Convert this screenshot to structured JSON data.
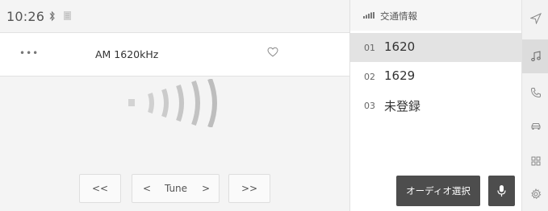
{
  "status_bar": {
    "time": "10:26",
    "icons": [
      "bluetooth-icon",
      "phone-signal-icon"
    ]
  },
  "now_playing": {
    "more_icon": "•••",
    "station_label": "AM 1620kHz",
    "favorite_icon": "heart-outline-icon"
  },
  "controls": {
    "seek_down_label": "<<",
    "tune_prev_label": "<",
    "tune_label": "Tune",
    "tune_next_label": ">",
    "seek_up_label": ">>"
  },
  "list": {
    "header_label": "交通情報",
    "presets": [
      {
        "number": "01",
        "label": "1620",
        "selected": true
      },
      {
        "number": "02",
        "label": "1629",
        "selected": false
      },
      {
        "number": "03",
        "label": "未登録",
        "selected": false
      }
    ]
  },
  "actions": {
    "audio_select_label": "オーディオ選択",
    "mic_icon": "microphone-icon"
  },
  "sidebar": {
    "items": [
      {
        "icon": "navigation-icon"
      },
      {
        "icon": "music-note-icon",
        "active": true
      },
      {
        "icon": "phone-icon"
      },
      {
        "icon": "car-icon"
      },
      {
        "icon": "apps-grid-icon"
      },
      {
        "icon": "settings-gear-icon"
      }
    ]
  },
  "colors": {
    "background_left": "#f4f4f4",
    "selected_row": "#e3e3e3",
    "dark_button": "#4d4d4d",
    "text": "#333333"
  }
}
